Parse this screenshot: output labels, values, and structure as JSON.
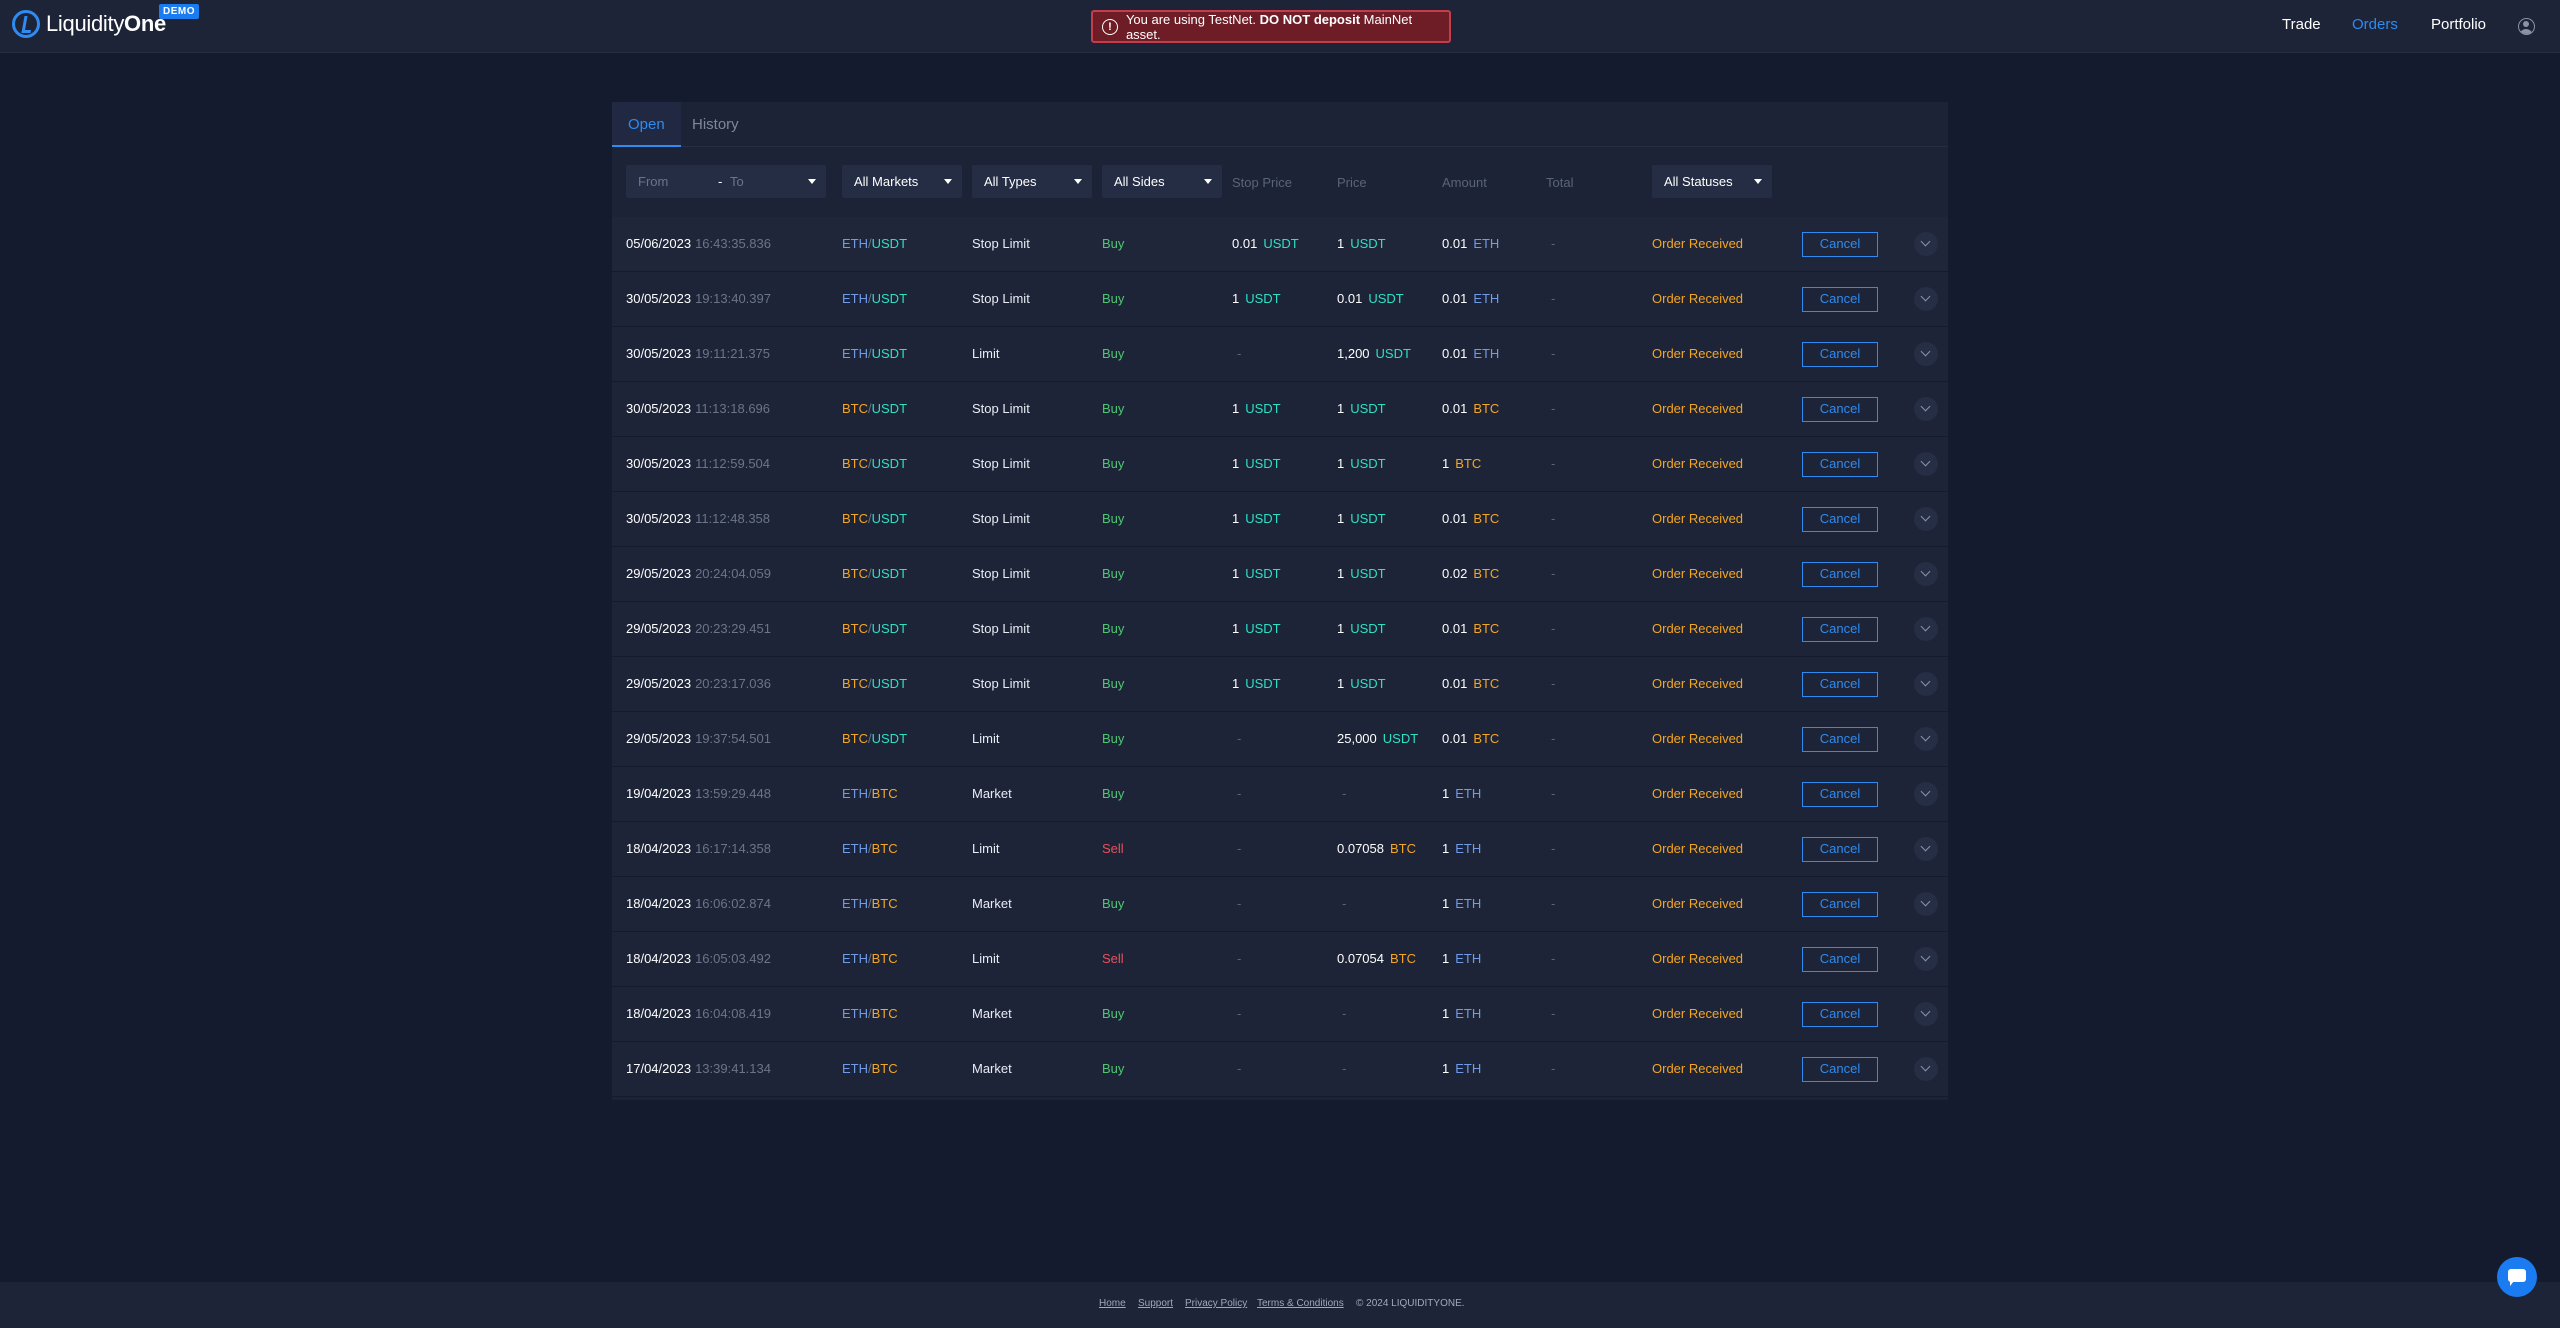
{
  "header": {
    "logo_light": "Liquidity",
    "logo_bold": "One",
    "badge": "DEMO",
    "warning_prefix": "You are using TestNet.",
    "warning_bold": "DO NOT deposit",
    "warning_suffix": "MainNet asset.",
    "warning_icon": "!",
    "nav": [
      "Trade",
      "Orders",
      "Portfolio"
    ],
    "active_nav": "Orders"
  },
  "tabs": [
    "Open",
    "History"
  ],
  "filters": {
    "from_placeholder": "From",
    "separator": "-",
    "to_placeholder": "To",
    "markets": "All Markets",
    "types": "All Types",
    "sides": "All Sides",
    "stop_price": "Stop Price",
    "price": "Price",
    "amount": "Amount",
    "total": "Total",
    "statuses": "All Statuses"
  },
  "orders": [
    {
      "date": "05/06/2023",
      "time": "16:43:35.836",
      "base": "ETH",
      "quote": "USDT",
      "type": "Stop Limit",
      "side": "Buy",
      "stop": "0.01",
      "stop_ccy": "USDT",
      "price": "1",
      "price_ccy": "USDT",
      "amount": "0.01",
      "amount_ccy": "ETH",
      "total": "-",
      "status": "Order Received",
      "action": "Cancel"
    },
    {
      "date": "30/05/2023",
      "time": "19:13:40.397",
      "base": "ETH",
      "quote": "USDT",
      "type": "Stop Limit",
      "side": "Buy",
      "stop": "1",
      "stop_ccy": "USDT",
      "price": "0.01",
      "price_ccy": "USDT",
      "amount": "0.01",
      "amount_ccy": "ETH",
      "total": "-",
      "status": "Order Received",
      "action": "Cancel"
    },
    {
      "date": "30/05/2023",
      "time": "19:11:21.375",
      "base": "ETH",
      "quote": "USDT",
      "type": "Limit",
      "side": "Buy",
      "stop": "-",
      "stop_ccy": "",
      "price": "1,200",
      "price_ccy": "USDT",
      "amount": "0.01",
      "amount_ccy": "ETH",
      "total": "-",
      "status": "Order Received",
      "action": "Cancel"
    },
    {
      "date": "30/05/2023",
      "time": "11:13:18.696",
      "base": "BTC",
      "quote": "USDT",
      "type": "Stop Limit",
      "side": "Buy",
      "stop": "1",
      "stop_ccy": "USDT",
      "price": "1",
      "price_ccy": "USDT",
      "amount": "0.01",
      "amount_ccy": "BTC",
      "total": "-",
      "status": "Order Received",
      "action": "Cancel"
    },
    {
      "date": "30/05/2023",
      "time": "11:12:59.504",
      "base": "BTC",
      "quote": "USDT",
      "type": "Stop Limit",
      "side": "Buy",
      "stop": "1",
      "stop_ccy": "USDT",
      "price": "1",
      "price_ccy": "USDT",
      "amount": "1",
      "amount_ccy": "BTC",
      "total": "-",
      "status": "Order Received",
      "action": "Cancel"
    },
    {
      "date": "30/05/2023",
      "time": "11:12:48.358",
      "base": "BTC",
      "quote": "USDT",
      "type": "Stop Limit",
      "side": "Buy",
      "stop": "1",
      "stop_ccy": "USDT",
      "price": "1",
      "price_ccy": "USDT",
      "amount": "0.01",
      "amount_ccy": "BTC",
      "total": "-",
      "status": "Order Received",
      "action": "Cancel"
    },
    {
      "date": "29/05/2023",
      "time": "20:24:04.059",
      "base": "BTC",
      "quote": "USDT",
      "type": "Stop Limit",
      "side": "Buy",
      "stop": "1",
      "stop_ccy": "USDT",
      "price": "1",
      "price_ccy": "USDT",
      "amount": "0.02",
      "amount_ccy": "BTC",
      "total": "-",
      "status": "Order Received",
      "action": "Cancel"
    },
    {
      "date": "29/05/2023",
      "time": "20:23:29.451",
      "base": "BTC",
      "quote": "USDT",
      "type": "Stop Limit",
      "side": "Buy",
      "stop": "1",
      "stop_ccy": "USDT",
      "price": "1",
      "price_ccy": "USDT",
      "amount": "0.01",
      "amount_ccy": "BTC",
      "total": "-",
      "status": "Order Received",
      "action": "Cancel"
    },
    {
      "date": "29/05/2023",
      "time": "20:23:17.036",
      "base": "BTC",
      "quote": "USDT",
      "type": "Stop Limit",
      "side": "Buy",
      "stop": "1",
      "stop_ccy": "USDT",
      "price": "1",
      "price_ccy": "USDT",
      "amount": "0.01",
      "amount_ccy": "BTC",
      "total": "-",
      "status": "Order Received",
      "action": "Cancel"
    },
    {
      "date": "29/05/2023",
      "time": "19:37:54.501",
      "base": "BTC",
      "quote": "USDT",
      "type": "Limit",
      "side": "Buy",
      "stop": "-",
      "stop_ccy": "",
      "price": "25,000",
      "price_ccy": "USDT",
      "amount": "0.01",
      "amount_ccy": "BTC",
      "total": "-",
      "status": "Order Received",
      "action": "Cancel"
    },
    {
      "date": "19/04/2023",
      "time": "13:59:29.448",
      "base": "ETH",
      "quote": "BTC",
      "type": "Market",
      "side": "Buy",
      "stop": "-",
      "stop_ccy": "",
      "price": "-",
      "price_ccy": "",
      "amount": "1",
      "amount_ccy": "ETH",
      "total": "-",
      "status": "Order Received",
      "action": "Cancel"
    },
    {
      "date": "18/04/2023",
      "time": "16:17:14.358",
      "base": "ETH",
      "quote": "BTC",
      "type": "Limit",
      "side": "Sell",
      "stop": "-",
      "stop_ccy": "",
      "price": "0.07058",
      "price_ccy": "BTC",
      "amount": "1",
      "amount_ccy": "ETH",
      "total": "-",
      "status": "Order Received",
      "action": "Cancel"
    },
    {
      "date": "18/04/2023",
      "time": "16:06:02.874",
      "base": "ETH",
      "quote": "BTC",
      "type": "Market",
      "side": "Buy",
      "stop": "-",
      "stop_ccy": "",
      "price": "-",
      "price_ccy": "",
      "amount": "1",
      "amount_ccy": "ETH",
      "total": "-",
      "status": "Order Received",
      "action": "Cancel"
    },
    {
      "date": "18/04/2023",
      "time": "16:05:03.492",
      "base": "ETH",
      "quote": "BTC",
      "type": "Limit",
      "side": "Sell",
      "stop": "-",
      "stop_ccy": "",
      "price": "0.07054",
      "price_ccy": "BTC",
      "amount": "1",
      "amount_ccy": "ETH",
      "total": "-",
      "status": "Order Received",
      "action": "Cancel"
    },
    {
      "date": "18/04/2023",
      "time": "16:04:08.419",
      "base": "ETH",
      "quote": "BTC",
      "type": "Market",
      "side": "Buy",
      "stop": "-",
      "stop_ccy": "",
      "price": "-",
      "price_ccy": "",
      "amount": "1",
      "amount_ccy": "ETH",
      "total": "-",
      "status": "Order Received",
      "action": "Cancel"
    },
    {
      "date": "17/04/2023",
      "time": "13:39:41.134",
      "base": "ETH",
      "quote": "BTC",
      "type": "Market",
      "side": "Buy",
      "stop": "-",
      "stop_ccy": "",
      "price": "-",
      "price_ccy": "",
      "amount": "1",
      "amount_ccy": "ETH",
      "total": "-",
      "status": "Order Received",
      "action": "Cancel"
    }
  ],
  "footer": {
    "links": [
      "Home",
      "Support",
      "Privacy Policy",
      "Terms & Conditions"
    ],
    "copyright": "© 2024 LIQUIDITYONE."
  },
  "colors": {
    "accent": "#2f8bf0",
    "buy": "#4fc672",
    "sell": "#e8505b",
    "status": "#f5a623",
    "eth": "#6f9be8",
    "btc": "#f5a623",
    "usdt": "#2ee0c4",
    "warning_bg": "#6e1d27"
  },
  "icons": [
    "logo-icon",
    "warning-icon",
    "user-icon",
    "chevron-down-icon",
    "chat-icon"
  ]
}
